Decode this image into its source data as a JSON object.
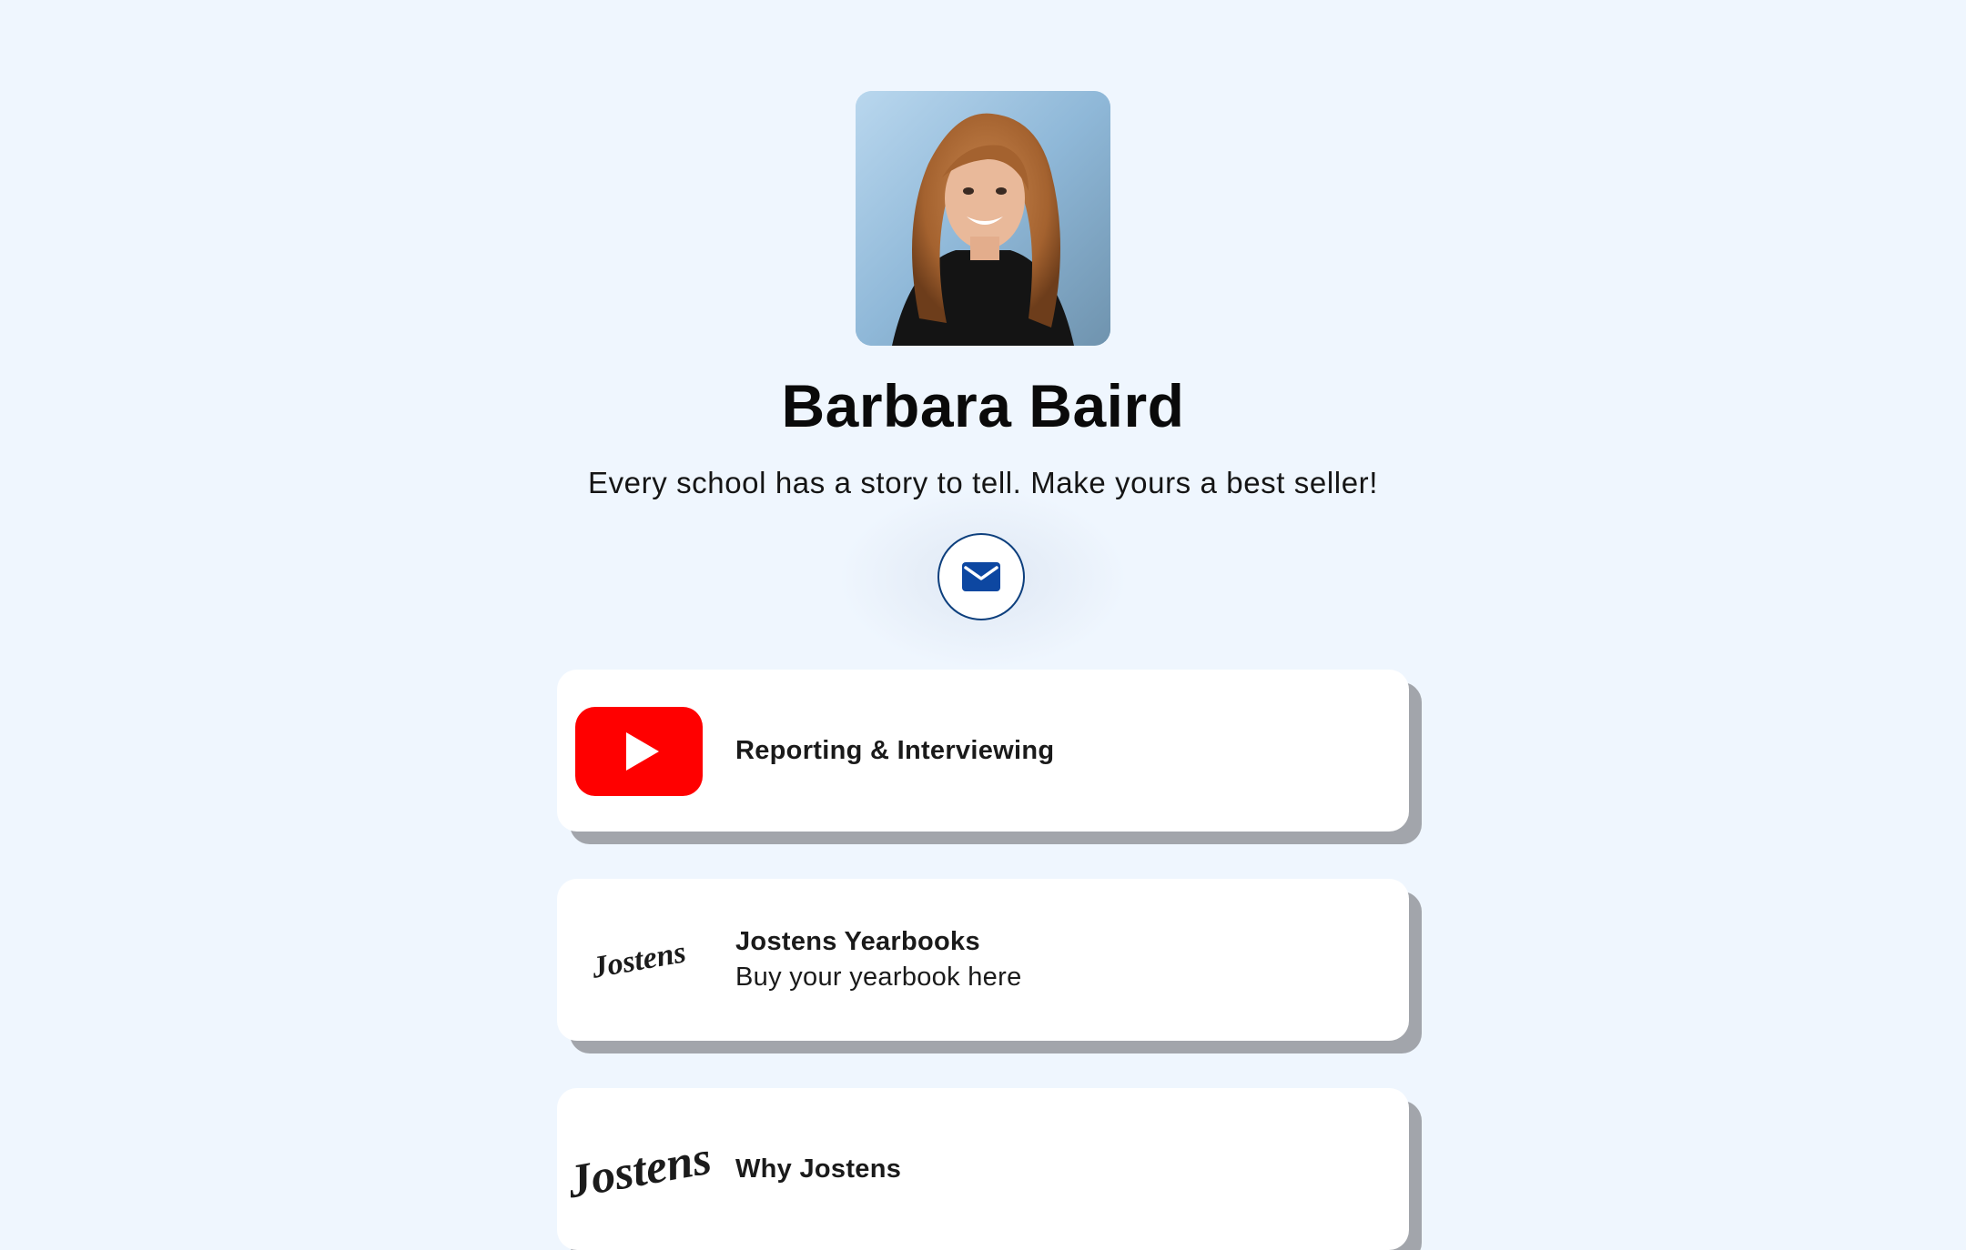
{
  "profile": {
    "name": "Barbara Baird",
    "tagline": "Every school has a story to tell. Make yours a best seller!",
    "avatar_alt": "profile photo"
  },
  "social": {
    "email_icon": "mail-icon"
  },
  "links": [
    {
      "title": "Reporting & Interviewing",
      "subtitle": "",
      "thumbnail": "youtube-icon"
    },
    {
      "title": "Jostens Yearbooks",
      "subtitle": "Buy your yearbook here",
      "thumbnail": "jostens-logo",
      "logo_text": "Jostens"
    },
    {
      "title": "Why Jostens",
      "subtitle": "",
      "thumbnail": "jostens-logo",
      "logo_text": "Jostens"
    }
  ],
  "colors": {
    "background": "#eff6fe",
    "card": "#ffffff",
    "card_shadow": "#a2a5ab",
    "accent": "#0d3f7d",
    "youtube_red": "#ff0000"
  }
}
